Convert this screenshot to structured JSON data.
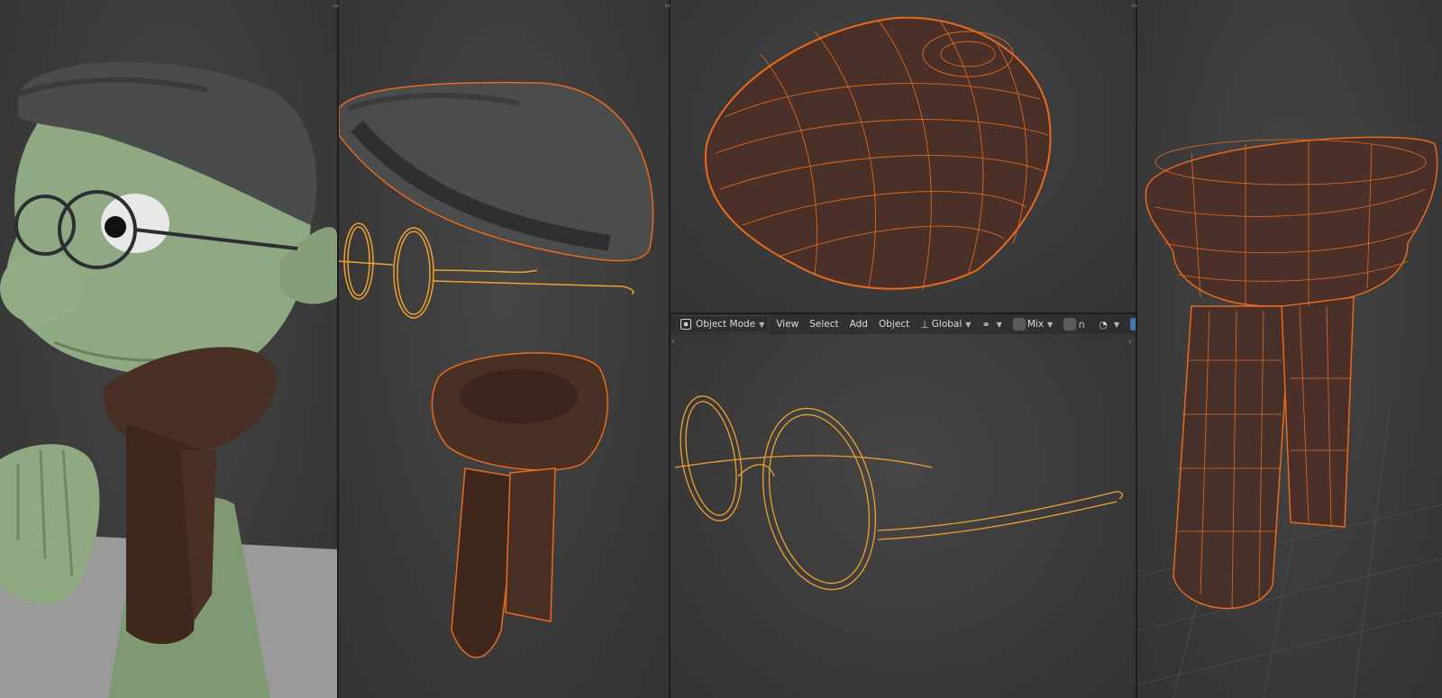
{
  "app": "3D viewport layout",
  "toolbar": {
    "mode": "Object Mode",
    "menus": [
      "View",
      "Select",
      "Add",
      "Object"
    ],
    "orientation": "Global",
    "snap_target": "Mix"
  },
  "colors": {
    "viewport_bg": "#3a3a3a",
    "selection_outline": "#e86a1c",
    "wire_light": "#f0a030",
    "skin": "#8fa982",
    "cap": "#4a4c4c",
    "scarf": "#4a2f24"
  },
  "icons": [
    "area-split-icon",
    "object-mode-icon",
    "transform-orientation-icon",
    "snap-icon",
    "proportional-edit-icon",
    "gizmo-icon",
    "overlay-icon"
  ]
}
